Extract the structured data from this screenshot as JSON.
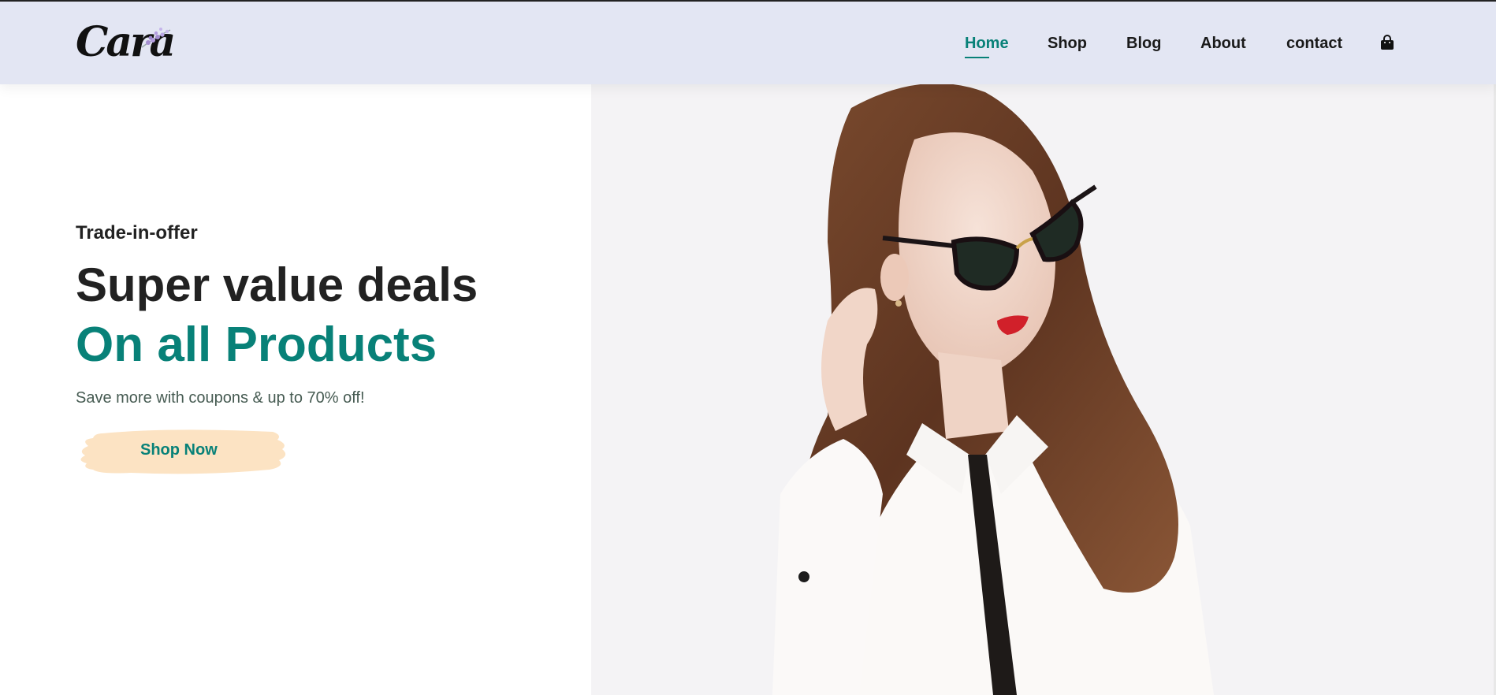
{
  "logo": {
    "text": "Cara"
  },
  "nav": {
    "items": [
      {
        "label": "Home",
        "active": true
      },
      {
        "label": "Shop",
        "active": false
      },
      {
        "label": "Blog",
        "active": false
      },
      {
        "label": "About",
        "active": false
      },
      {
        "label": "contact",
        "active": false
      }
    ],
    "cart_icon": "shopping-bag-icon"
  },
  "hero": {
    "subtitle": "Trade-in-offer",
    "heading": "Super value deals",
    "highlight": "On all Products",
    "description": "Save more with coupons & up to 70% off!",
    "button_label": "Shop Now"
  },
  "colors": {
    "accent": "#088178",
    "header_bg": "#e3e6f3",
    "button_bg": "#fce3c3",
    "text_dark": "#222222"
  }
}
